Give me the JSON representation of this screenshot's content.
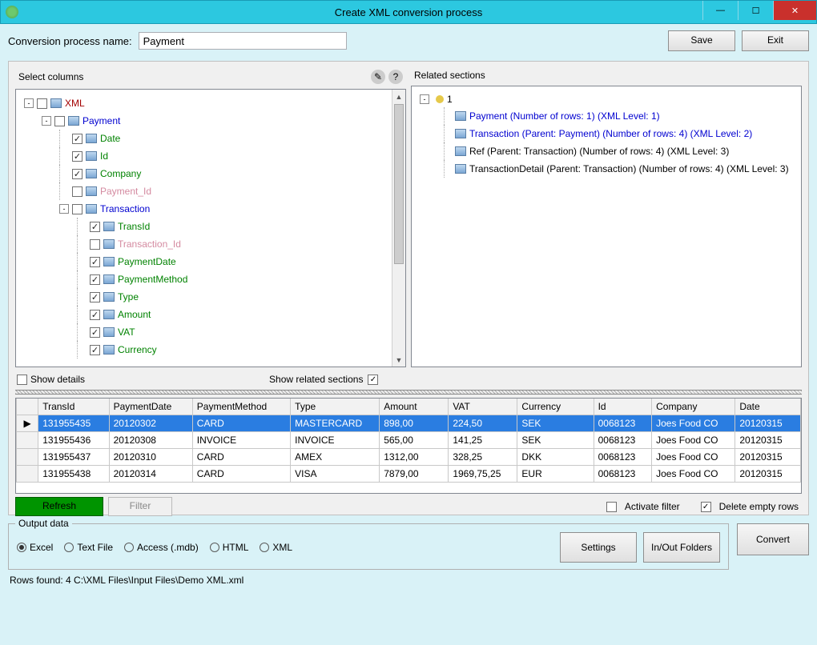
{
  "window": {
    "title": "Create XML conversion process",
    "min": "—",
    "max": "☐",
    "close": "✕"
  },
  "top": {
    "label": "Conversion process name:",
    "value": "Payment",
    "save": "Save",
    "exit": "Exit"
  },
  "panels": {
    "select_columns": "Select columns",
    "related_sections": "Related sections",
    "show_details": "Show details",
    "show_related": "Show related sections"
  },
  "tree": [
    {
      "d": 0,
      "exp": "-",
      "cb": "empty",
      "txt": "XML",
      "cls": "c-red"
    },
    {
      "d": 1,
      "exp": "-",
      "cb": "empty",
      "txt": "Payment",
      "cls": "c-blue"
    },
    {
      "d": 2,
      "exp": "",
      "cb": "checked",
      "txt": "Date",
      "cls": "c-green"
    },
    {
      "d": 2,
      "exp": "",
      "cb": "checked",
      "txt": "Id",
      "cls": "c-green"
    },
    {
      "d": 2,
      "exp": "",
      "cb": "checked",
      "txt": "Company",
      "cls": "c-green"
    },
    {
      "d": 2,
      "exp": "",
      "cb": "empty",
      "txt": "Payment_Id",
      "cls": "c-pink"
    },
    {
      "d": 2,
      "exp": "-",
      "cb": "empty",
      "txt": "Transaction",
      "cls": "c-blue"
    },
    {
      "d": 3,
      "exp": "",
      "cb": "checked",
      "txt": "TransId",
      "cls": "c-green"
    },
    {
      "d": 3,
      "exp": "",
      "cb": "empty",
      "txt": "Transaction_Id",
      "cls": "c-pink"
    },
    {
      "d": 3,
      "exp": "",
      "cb": "checked",
      "txt": "PaymentDate",
      "cls": "c-green"
    },
    {
      "d": 3,
      "exp": "",
      "cb": "checked",
      "txt": "PaymentMethod",
      "cls": "c-green"
    },
    {
      "d": 3,
      "exp": "",
      "cb": "checked",
      "txt": "Type",
      "cls": "c-green"
    },
    {
      "d": 3,
      "exp": "",
      "cb": "checked",
      "txt": "Amount",
      "cls": "c-green"
    },
    {
      "d": 3,
      "exp": "",
      "cb": "checked",
      "txt": "VAT",
      "cls": "c-green"
    },
    {
      "d": 3,
      "exp": "",
      "cb": "checked",
      "txt": "Currency",
      "cls": "c-green"
    }
  ],
  "related": {
    "root": "1",
    "items": [
      {
        "txt": "Payment (Number of rows: 1) (XML Level: 1)",
        "cls": "c-blue"
      },
      {
        "txt": "Transaction (Parent: Payment) (Number of rows: 4) (XML Level: 2)",
        "cls": "c-blue"
      },
      {
        "txt": "Ref (Parent: Transaction) (Number of rows: 4) (XML Level: 3)",
        "cls": "c-black"
      },
      {
        "txt": "TransactionDetail (Parent: Transaction) (Number of rows: 4) (XML Level: 3)",
        "cls": "c-black"
      }
    ]
  },
  "grid": {
    "headers": [
      "TransId",
      "PaymentDate",
      "PaymentMethod",
      "Type",
      "Amount",
      "VAT",
      "Currency",
      "Id",
      "Company",
      "Date"
    ],
    "rows": [
      [
        "131955435",
        "20120302",
        "CARD",
        "MASTERCARD",
        "898,00",
        "224,50",
        "SEK",
        "0068123",
        "Joes Food CO",
        "20120315"
      ],
      [
        "131955436",
        "20120308",
        "INVOICE",
        "INVOICE",
        "565,00",
        "141,25",
        "SEK",
        "0068123",
        "Joes Food CO",
        "20120315"
      ],
      [
        "131955437",
        "20120310",
        "CARD",
        "AMEX",
        "1312,00",
        "328,25",
        "DKK",
        "0068123",
        "Joes Food CO",
        "20120315"
      ],
      [
        "131955438",
        "20120314",
        "CARD",
        "VISA",
        "7879,00",
        "1969,75,25",
        "EUR",
        "0068123",
        "Joes Food CO",
        "20120315"
      ]
    ],
    "refresh": "Refresh",
    "filter": "Filter",
    "activate_filter": "Activate filter",
    "delete_empty": "Delete empty rows"
  },
  "output": {
    "legend": "Output data",
    "radios": [
      "Excel",
      "Text File",
      "Access (.mdb)",
      "HTML",
      "XML"
    ],
    "settings": "Settings",
    "folders": "In/Out Folders",
    "convert": "Convert"
  },
  "status": "Rows found: 4  C:\\XML Files\\Input Files\\Demo XML.xml"
}
